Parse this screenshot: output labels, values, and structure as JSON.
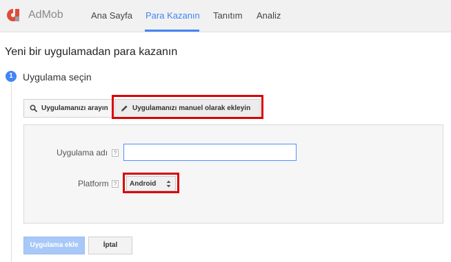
{
  "app": {
    "brand": "AdMob"
  },
  "nav": {
    "tabs": [
      {
        "label": "Ana Sayfa",
        "active": false
      },
      {
        "label": "Para Kazanın",
        "active": true
      },
      {
        "label": "Tanıtım",
        "active": false
      },
      {
        "label": "Analiz",
        "active": false
      }
    ]
  },
  "page": {
    "title": "Yeni bir uygulamadan para kazanın"
  },
  "step": {
    "number": "1",
    "title": "Uygulama seçin",
    "modes": {
      "search_label": "Uygulamanızı arayın",
      "manual_label": "Uygulamanızı manuel olarak ekleyin"
    }
  },
  "form": {
    "app_name_label": "Uygulama adı",
    "app_name_value": "",
    "platform_label": "Platform",
    "platform_selected": "Android",
    "help_glyph": "?"
  },
  "actions": {
    "add_label": "Uygulama ekle",
    "cancel_label": "İptal"
  },
  "colors": {
    "accent": "#4285f4",
    "highlight_red": "#d90000",
    "logo_red": "#dd4b39",
    "add_button_disabled": "#a8c8f8"
  },
  "icons": {
    "logo": "admob-logo-icon",
    "search": "search-icon",
    "manual": "pencil-icon",
    "select": "up-down-arrows-icon"
  }
}
